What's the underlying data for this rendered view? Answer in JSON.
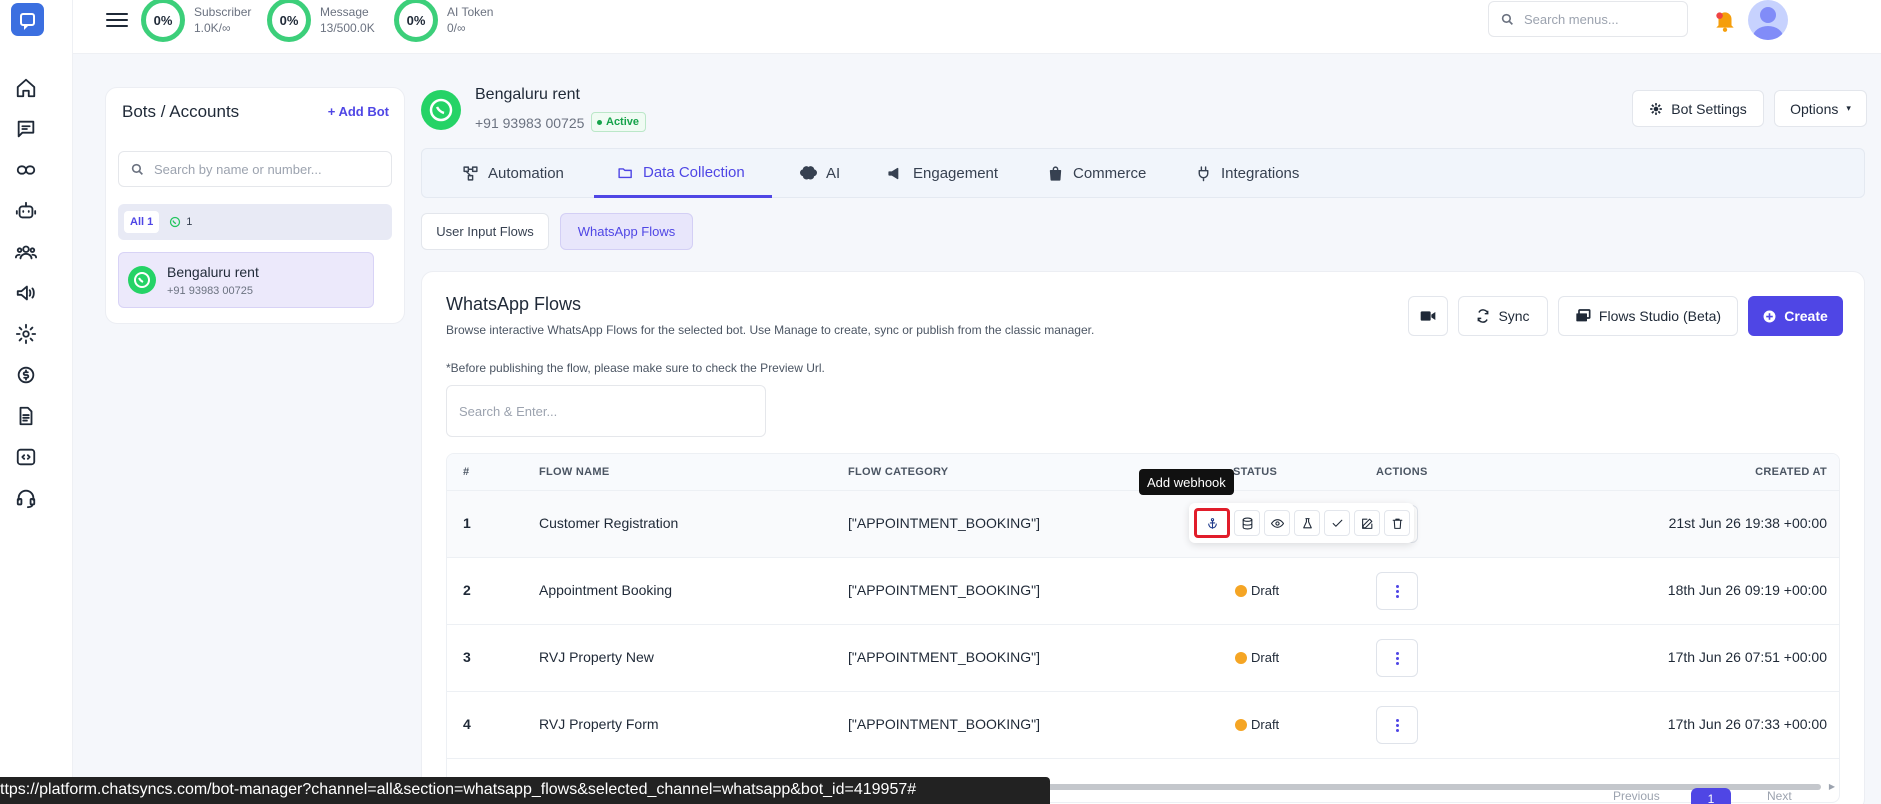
{
  "topbar": {
    "stats": [
      {
        "percent": "0%",
        "label": "Subscriber",
        "value": "1.0K/∞"
      },
      {
        "percent": "0%",
        "label": "Message",
        "value": "13/500.0K"
      },
      {
        "percent": "0%",
        "label": "AI Token",
        "value": "0/∞"
      }
    ],
    "search_placeholder": "Search menus..."
  },
  "sidebar": {
    "icons": [
      "home-icon",
      "message-icon",
      "link-icon",
      "bot-icon",
      "users-icon",
      "megaphone-icon",
      "settings-icon",
      "billing-icon",
      "document-icon",
      "code-icon",
      "support-icon"
    ]
  },
  "bots_panel": {
    "title": "Bots / Accounts",
    "add_bot": "Add Bot",
    "search_placeholder": "Search by name or number...",
    "filter_all": "All 1",
    "filter_whatsapp_count": "1",
    "bots": [
      {
        "name": "Bengaluru rent",
        "number": "+91 93983 00725"
      }
    ]
  },
  "bot_header": {
    "name": "Bengaluru rent",
    "number": "+91 93983 00725",
    "status": "Active",
    "bot_settings": "Bot Settings",
    "options": "Options"
  },
  "tabs": [
    {
      "label": "Automation"
    },
    {
      "label": "Data Collection"
    },
    {
      "label": "AI"
    },
    {
      "label": "Engagement"
    },
    {
      "label": "Commerce"
    },
    {
      "label": "Integrations"
    }
  ],
  "subtabs": {
    "user_input": "User Input Flows",
    "whatsapp": "WhatsApp Flows"
  },
  "card": {
    "title": "WhatsApp Flows",
    "description": "Browse interactive WhatsApp Flows for the selected bot. Use Manage to create, sync or publish from the classic manager.",
    "note": "*Before publishing the flow, please make sure to check the Preview Url.",
    "search_placeholder": "Search & Enter...",
    "sync": "Sync",
    "flows_studio": "Flows Studio (Beta)",
    "create": "Create"
  },
  "table": {
    "headers": {
      "num": "#",
      "name": "FLOW NAME",
      "category": "FLOW CATEGORY",
      "status": "STATUS",
      "actions": "ACTIONS",
      "created": "CREATED AT"
    },
    "rows": [
      {
        "num": "1",
        "name": "Customer Registration",
        "category": "[\"APPOINTMENT_BOOKING\"]",
        "status": "",
        "created": "21st Jun 26 19:38 +00:00"
      },
      {
        "num": "2",
        "name": "Appointment Booking",
        "category": "[\"APPOINTMENT_BOOKING\"]",
        "status": "Draft",
        "created": "18th Jun 26 09:19 +00:00"
      },
      {
        "num": "3",
        "name": "RVJ Property New",
        "category": "[\"APPOINTMENT_BOOKING\"]",
        "status": "Draft",
        "created": "17th Jun 26 07:51 +00:00"
      },
      {
        "num": "4",
        "name": "RVJ Property Form",
        "category": "[\"APPOINTMENT_BOOKING\"]",
        "status": "Draft",
        "created": "17th Jun 26 07:33 +00:00"
      }
    ],
    "tooltip": "Add webhook"
  },
  "pagination": {
    "previous": "Previous",
    "page": "1",
    "next": "Next"
  },
  "status_url": "ttps://platform.chatsyncs.com/bot-manager?channel=all&section=whatsapp_flows&selected_channel=whatsapp&bot_id=419957#",
  "colors": {
    "accent": "#4f46e5",
    "ring": "#3ccf7a",
    "whatsapp": "#25d366",
    "draft": "#f5a524",
    "highlight": "#e11d2a"
  }
}
